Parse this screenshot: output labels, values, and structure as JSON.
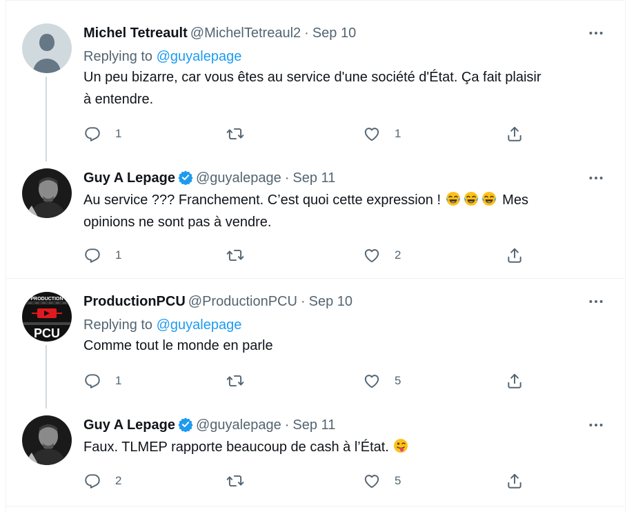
{
  "colors": {
    "accent": "#1d9bf0",
    "secondary_text": "#536471",
    "primary_text": "#0f1419",
    "divider": "#eff3f4"
  },
  "tweets": [
    {
      "name": "Michel Tetreault",
      "handle": "@MichelTetreaul2",
      "separator": "·",
      "date": "Sep 10",
      "verified": false,
      "replying_label": "Replying to",
      "replying_to": "@guyalepage",
      "text_lines": [
        "Un peu bizarre, car vous êtes au service d'une société d'État. Ça fait plaisir",
        "à entendre."
      ],
      "replies": "1",
      "retweets": "",
      "likes": "1",
      "avatar": "default-avatar"
    },
    {
      "name": "Guy A Lepage",
      "handle": "@guyalepage",
      "separator": "·",
      "date": "Sep 11",
      "verified": true,
      "text_line1": "Au service ??? Franchement. C’est quoi cette expression ! ",
      "text_line1_after": "Mes",
      "emojis": [
        "tears-of-joy-emoji",
        "tears-of-joy-emoji",
        "tears-of-joy-emoji"
      ],
      "text_line2": "opinions ne sont pas à vendre.",
      "replies": "1",
      "retweets": "",
      "likes": "2",
      "avatar": "photo-avatar"
    },
    {
      "name": "ProductionPCU",
      "handle": "@ProductionPCU",
      "separator": "·",
      "date": "Sep 10",
      "verified": false,
      "replying_label": "Replying to",
      "replying_to": "@guyalepage",
      "text_lines": [
        "Comme tout le monde en parle"
      ],
      "replies": "1",
      "retweets": "",
      "likes": "5",
      "avatar": "logo-avatar",
      "avatar_logo_top": "PRODUCTION",
      "avatar_logo_bottom": "PCU"
    },
    {
      "name": "Guy A Lepage",
      "handle": "@guyalepage",
      "separator": "·",
      "date": "Sep 11",
      "verified": true,
      "text_line1": "Faux. TLMEP rapporte beaucoup de cash à l’État. ",
      "emojis": [
        "winking-tongue-emoji"
      ],
      "replies": "2",
      "retweets": "",
      "likes": "5",
      "avatar": "photo-avatar"
    }
  ]
}
